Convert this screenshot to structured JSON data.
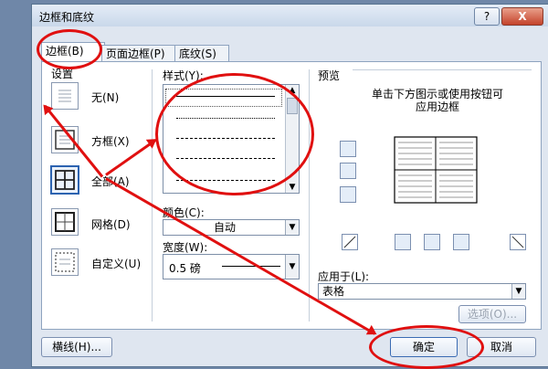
{
  "dialog": {
    "title": "边框和底纹",
    "help_label": "?",
    "close_label": "X"
  },
  "tabs": [
    "边框(B)",
    "页面边框(P)",
    "底纹(S)"
  ],
  "settings": {
    "label": "设置",
    "items": [
      {
        "label": "无(N)"
      },
      {
        "label": "方框(X)"
      },
      {
        "label": "全部(A)"
      },
      {
        "label": "网格(D)"
      },
      {
        "label": "自定义(U)"
      }
    ]
  },
  "style": {
    "label": "样式(Y):",
    "options": [
      "solid",
      "dotted",
      "dashed",
      "dashed",
      "dash-dot"
    ]
  },
  "color": {
    "label": "颜色(C):",
    "value": "自动"
  },
  "width": {
    "label": "宽度(W):",
    "value": "0.5 磅"
  },
  "preview": {
    "label": "预览",
    "hint_line1": "单击下方图示或使用按钮可",
    "hint_line2": "应用边框"
  },
  "apply_to": {
    "label": "应用于(L):",
    "value": "表格"
  },
  "buttons": {
    "options": "选项(O)...",
    "horizontal_line": "横线(H)...",
    "ok": "确定",
    "cancel": "取消"
  },
  "colors": {
    "annotation": "#e01010",
    "accent": "#2c63b0"
  }
}
